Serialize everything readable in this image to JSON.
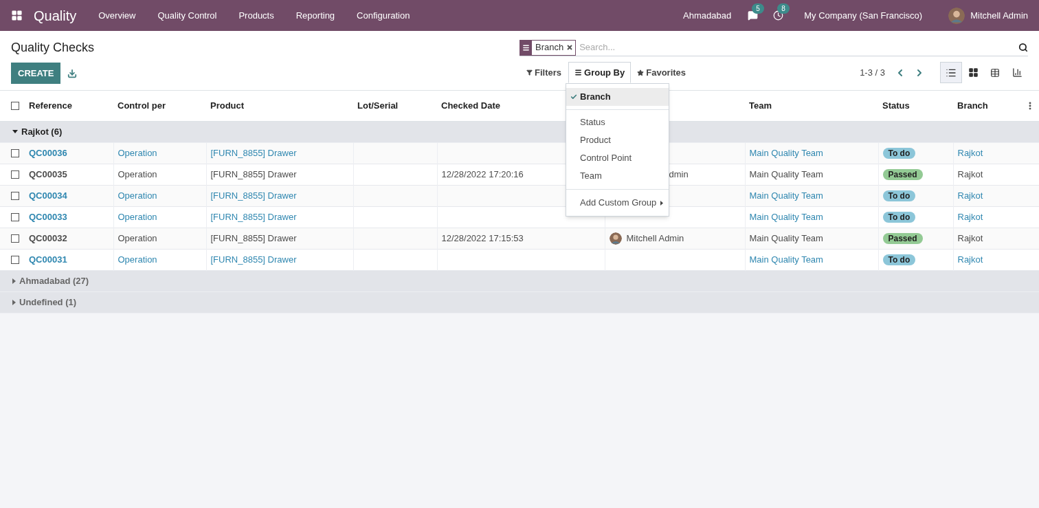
{
  "navbar": {
    "app_name": "Quality",
    "menu": [
      "Overview",
      "Quality Control",
      "Products",
      "Reporting",
      "Configuration"
    ],
    "branch": "Ahmadabad",
    "messages_count": "5",
    "activities_count": "8",
    "company": "My Company (San Francisco)",
    "user": "Mitchell Admin"
  },
  "control_panel": {
    "title": "Quality Checks",
    "create_label": "CREATE",
    "facet": {
      "label": "Branch"
    },
    "search_placeholder": "Search...",
    "filters_label": "Filters",
    "group_by_label": "Group By",
    "favorites_label": "Favorites",
    "pager": "1-3 / 3",
    "views": [
      {
        "kind": "list",
        "selected": true
      },
      {
        "kind": "kanban",
        "selected": false
      },
      {
        "kind": "pivot",
        "selected": false
      },
      {
        "kind": "graph",
        "selected": false
      }
    ]
  },
  "group_by_menu": {
    "items": [
      {
        "label": "Branch",
        "selected": true
      },
      {
        "label": "Status",
        "selected": false
      },
      {
        "label": "Product",
        "selected": false
      },
      {
        "label": "Control Point",
        "selected": false
      },
      {
        "label": "Team",
        "selected": false
      }
    ],
    "custom_label": "Add Custom Group"
  },
  "table": {
    "columns": [
      "Reference",
      "Control per",
      "Product",
      "Lot/Serial",
      "Checked Date",
      "",
      "Team",
      "Status",
      "Branch"
    ],
    "select_all_checked": false,
    "groups": [
      {
        "label": "Rajkot (6)",
        "expanded": true,
        "rows": [
          {
            "checked": false,
            "reference": "QC00036",
            "control_per": "Operation",
            "product": "[FURN_8855] Drawer",
            "checked_date": "",
            "responsible": null,
            "team": "Main Quality Team",
            "status": {
              "label": "To do",
              "kind": "todo"
            },
            "branch": "Rajkot"
          },
          {
            "checked": false,
            "reference": "QC00035",
            "control_per": "Operation",
            "product": "[FURN_8855] Drawer",
            "checked_date": "12/28/2022 17:20:16",
            "responsible": {
              "name": "dmin",
              "covered": true
            },
            "team": "Main Quality Team",
            "status": {
              "label": "Passed",
              "kind": "passed"
            },
            "branch": "Rajkot"
          },
          {
            "checked": false,
            "reference": "QC00034",
            "control_per": "Operation",
            "product": "[FURN_8855] Drawer",
            "checked_date": "",
            "responsible": null,
            "team": "Main Quality Team",
            "status": {
              "label": "To do",
              "kind": "todo"
            },
            "branch": "Rajkot"
          },
          {
            "checked": false,
            "reference": "QC00033",
            "control_per": "Operation",
            "product": "[FURN_8855] Drawer",
            "checked_date": "",
            "responsible": null,
            "team": "Main Quality Team",
            "status": {
              "label": "To do",
              "kind": "todo"
            },
            "branch": "Rajkot"
          },
          {
            "checked": false,
            "reference": "QC00032",
            "control_per": "Operation",
            "product": "[FURN_8855] Drawer",
            "checked_date": "12/28/2022 17:15:53",
            "responsible": {
              "name": "Mitchell Admin",
              "covered": false
            },
            "team": "Main Quality Team",
            "status": {
              "label": "Passed",
              "kind": "passed"
            },
            "branch": "Rajkot"
          },
          {
            "checked": false,
            "reference": "QC00031",
            "control_per": "Operation",
            "product": "[FURN_8855] Drawer",
            "checked_date": "",
            "responsible": null,
            "team": "Main Quality Team",
            "status": {
              "label": "To do",
              "kind": "todo"
            },
            "branch": "Rajkot"
          }
        ]
      },
      {
        "label": "Ahmadabad (27)",
        "expanded": false
      },
      {
        "label": "Undefined (1)",
        "expanded": false
      }
    ]
  }
}
